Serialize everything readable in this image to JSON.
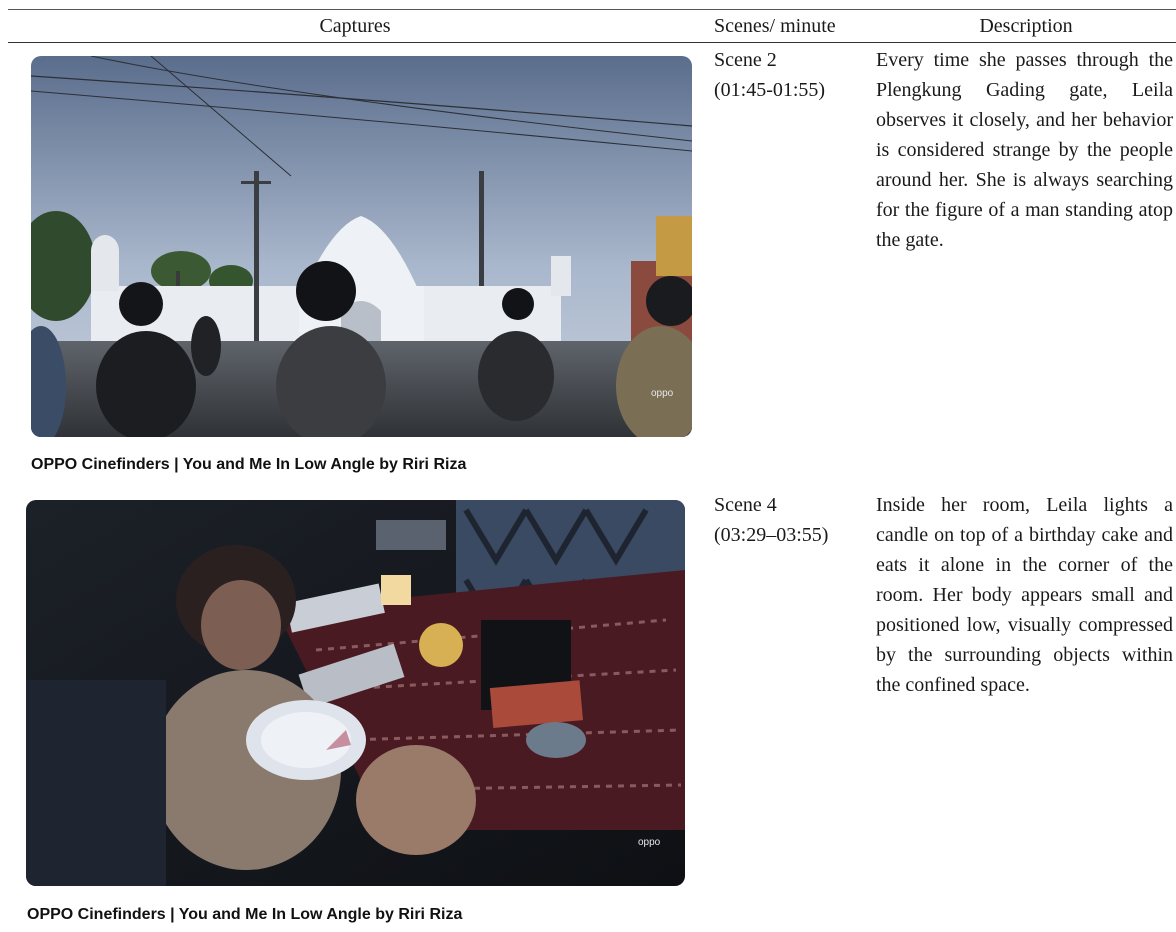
{
  "table": {
    "headers": {
      "captures": "Captures",
      "scenes": "Scenes/ minute",
      "description": "Description"
    },
    "rows": [
      {
        "image_alt": "Street scene at the Plengkung Gading gate with motorcyclists",
        "watermark": "oppo",
        "caption": "OPPO Cinefinders | You and Me In Low Angle by Riri Riza",
        "scene": "Scene 2",
        "minute": "(01:45-01:55)",
        "description": "Every time she passes through the Plengkung Gading gate, Leila observes it closely, and her behavior is considered strange by the people around her. She is always searching for the figure of a man standing atop the gate."
      },
      {
        "image_alt": "Girl eating birthday cake alone in a dim room",
        "watermark": "oppo",
        "caption": "OPPO Cinefinders | You and Me In Low Angle by Riri Riza",
        "scene": "Scene 4",
        "minute": "(03:29–03:55)",
        "description": "Inside her room, Leila lights a candle on top of a birthday cake and eats it alone in the corner of the room. Her body appears small and positioned low, visually compressed by the surrounding objects within the confined space."
      }
    ]
  }
}
